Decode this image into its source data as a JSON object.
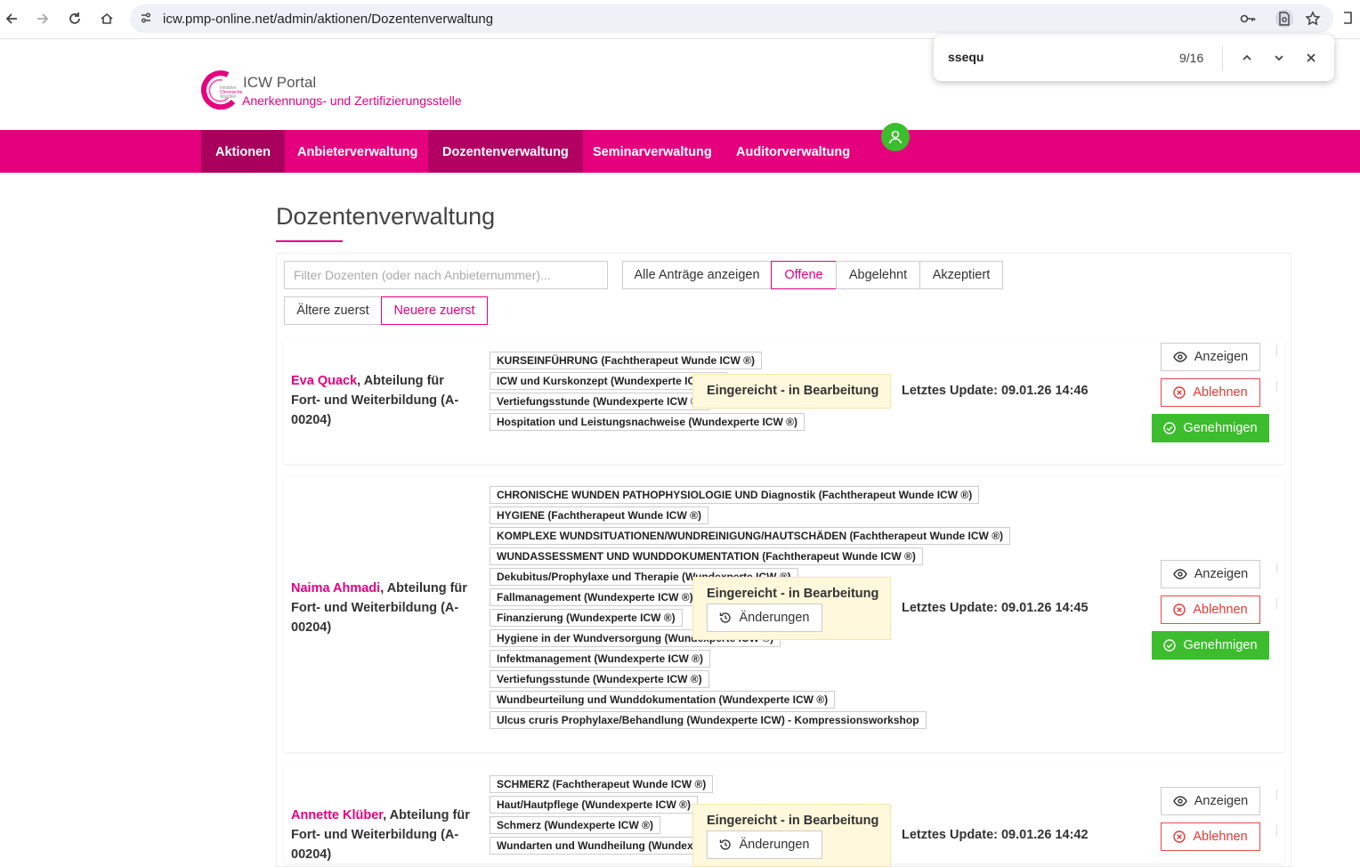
{
  "browser": {
    "url": "icw.pmp-online.net/admin/aktionen/Dozentenverwaltung",
    "find_query": "ssequ",
    "find_count": "9/16"
  },
  "brand": {
    "title": "ICW Portal",
    "subtitle": "Anerkennungs- und Zertifizierungsstelle"
  },
  "nav": [
    "Aktionen",
    "Anbieterverwaltung",
    "Dozentenverwaltung",
    "Seminarverwaltung",
    "Auditorverwaltung"
  ],
  "page": {
    "title": "Dozentenverwaltung",
    "filter_placeholder": "Filter Dozenten (oder nach Anbieternummer)...",
    "filters": [
      "Alle Anträge anzeigen",
      "Offene",
      "Abgelehnt",
      "Akzeptiert"
    ],
    "sort": [
      "Ältere zuerst",
      "Neuere zuerst"
    ]
  },
  "actions": {
    "view": "Anzeigen",
    "reject": "Ablehnen",
    "approve": "Genehmigen",
    "changes": "Änderungen"
  },
  "entries": [
    {
      "name": "Eva Quack",
      "org": ", Abteilung für Fort- und Weiterbildung (A-00204)",
      "status": "Eingereicht - in Bearbeitung",
      "update": "Letztes Update: 09.01.26 14:46",
      "courses": [
        "KURSEINFÜHRUNG (Fachtherapeut Wunde ICW ®)",
        "ICW und Kurskonzept (Wundexperte ICW ®)",
        "Vertiefungsstunde (Wundexperte ICW ®)",
        "Hospitation und Leistungsnachweise (Wundexperte ICW ®)"
      ]
    },
    {
      "name": "Naima Ahmadi",
      "org": ", Abteilung für Fort- und Weiterbildung (A-00204)",
      "status": "Eingereicht - in Bearbeitung",
      "update": "Letztes Update: 09.01.26 14:45",
      "courses": [
        "CHRONISCHE WUNDEN PATHOPHYSIOLOGIE UND Diagnostik (Fachtherapeut Wunde ICW ®)",
        "HYGIENE (Fachtherapeut Wunde ICW ®)",
        "KOMPLEXE WUNDSITUATIONEN/WUNDREINIGUNG/HAUTSCHÄDEN (Fachtherapeut Wunde ICW ®)",
        "WUNDASSESSMENT UND WUNDDOKUMENTATION (Fachtherapeut Wunde ICW ®)",
        "Dekubitus/Prophylaxe und Therapie (Wundexperte ICW ®)",
        "Fallmanagement (Wundexperte ICW ®)",
        "Finanzierung (Wundexperte ICW ®)",
        "Hygiene in der Wundversorgung (Wundexperte ICW ®)",
        "Infektmanagement (Wundexperte ICW ®)",
        "Vertiefungsstunde (Wundexperte ICW ®)",
        "Wundbeurteilung und Wunddokumentation (Wundexperte ICW ®)",
        "Ulcus cruris Prophylaxe/Behandlung (Wundexperte ICW) - Kompressionsworkshop"
      ]
    },
    {
      "name": "Annette Klüber",
      "org": ", Abteilung für Fort- und Weiterbildung (A-00204)",
      "status": "Eingereicht - in Bearbeitung",
      "update": "Letztes Update: 09.01.26 14:42",
      "courses": [
        "SCHMERZ (Fachtherapeut Wunde ICW ®)",
        "Haut/Hautpflege (Wundexperte ICW ®)",
        "Schmerz (Wundexperte ICW ®)",
        "Wundarten und Wundheilung (Wundexperte ICW ®)"
      ]
    }
  ]
}
